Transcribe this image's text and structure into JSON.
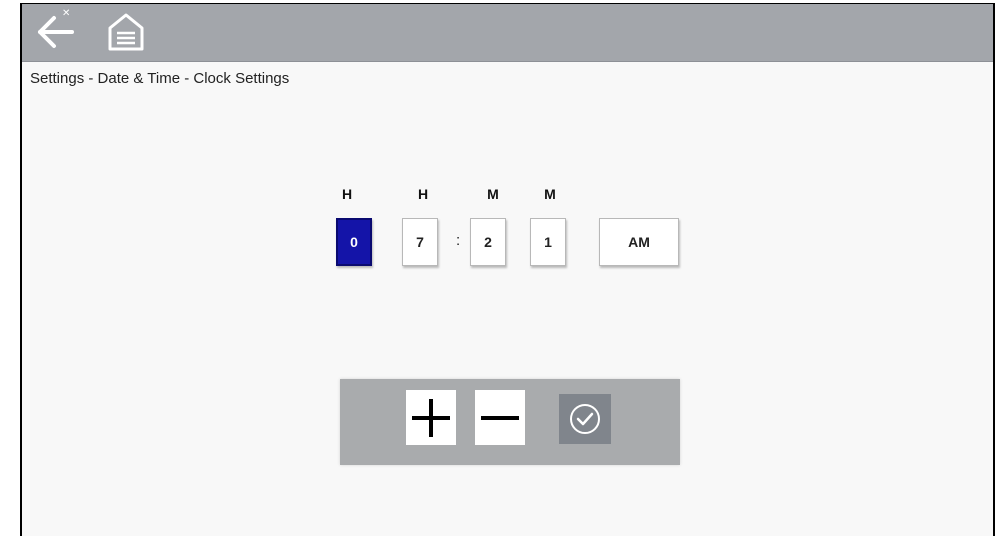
{
  "breadcrumb": "Settings - Date & Time - Clock Settings",
  "time": {
    "headers": [
      "H",
      "H",
      "M",
      "M"
    ],
    "digits": [
      "0",
      "7",
      "2",
      "1"
    ],
    "separator": ":",
    "ampm": "AM",
    "selected_index": 0
  },
  "icons": {
    "back": "back-arrow-icon",
    "home": "home-icon",
    "increase": "plus-icon",
    "decrease": "minus-icon",
    "confirm": "checkmark-icon"
  },
  "colors": {
    "topbar": "#a3a6ab",
    "selected_digit": "#1414a8",
    "panel": "#a9abad",
    "confirm_button": "#80858c"
  }
}
